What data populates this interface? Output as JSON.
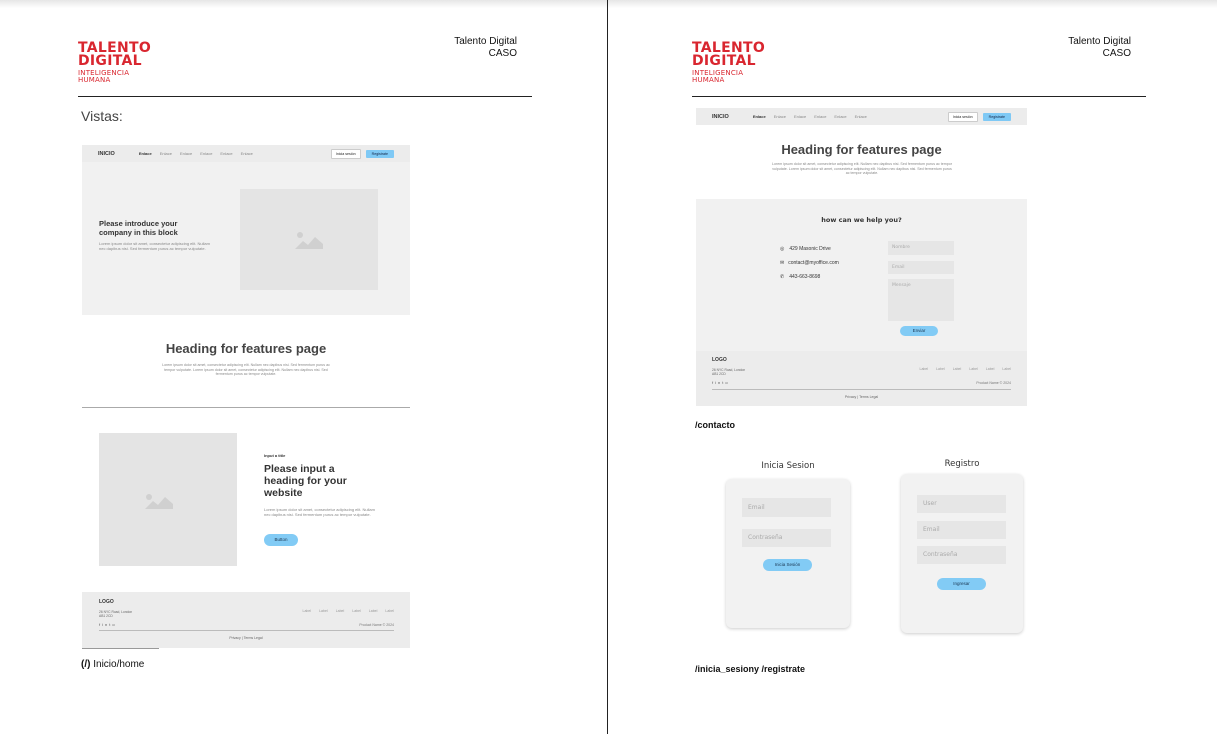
{
  "page1": {
    "logo": {
      "line1": "TALENTO",
      "line2": "DIGITAL",
      "line3": "INTELIGENCIA",
      "line4": "HUMANA"
    },
    "header_right": {
      "line1": "Talento Digital",
      "line2": "CASO"
    },
    "section_title": "Vistas:",
    "home": {
      "nav": {
        "logo": "INICIO",
        "links": [
          "Enlace",
          "Enlace",
          "Enlace",
          "Enlace",
          "Enlace",
          "Enlace"
        ],
        "login": "Inicia sesión",
        "register": "Registrate"
      },
      "hero": {
        "title_line1": "Please introduce your",
        "title_line2": "company in this block",
        "body": "Lorem ipsum dolor sit amet, consectetur adipiscing elit. Nullam nec dapibus nisi. Sed fermentum purus ac tempor vulputate."
      },
      "features": {
        "title": "Heading for features page",
        "body": "Lorem ipsum dolor sit amet, consectetur adipiscing elit. Nullam nec dapibus nisi. Sed fermentum purus ac tempor vulputate. Lorem ipsum dolor sit amet, consectetur adipiscing elit. Nullam nec dapibus nisi. Sed fermentum purus ac tempor vulputate."
      },
      "split": {
        "eyebrow": "Input a title",
        "title_line1": "Please input a",
        "title_line2": "heading for your",
        "title_line3": "website",
        "body": "Lorem ipsum dolor sit amet, consectetur adipiscing elit. Nullam nec dapibus nisi. Sed fermentum purus ac tempor vulputate.",
        "button": "Button"
      },
      "footer": {
        "logo": "LOGO",
        "address1": "26 NYC Road, London",
        "address2": "AB1 2CD",
        "links": [
          "Label",
          "Label",
          "Label",
          "Label",
          "Label",
          "Label"
        ],
        "copyright": "Product Name © 2024",
        "legal": "Privacy | Terms Legal"
      }
    },
    "caption_bold": "(/)",
    "caption": " Inicio/home"
  },
  "page2": {
    "logo": {
      "line1": "TALENTO",
      "line2": "DIGITAL",
      "line3": "INTELIGENCIA",
      "line4": "HUMANA"
    },
    "header_right": {
      "line1": "Talento Digital",
      "line2": "CASO"
    },
    "contact": {
      "nav": {
        "logo": "INICIO",
        "links": [
          "Enlace",
          "Enlace",
          "Enlace",
          "Enlace",
          "Enlace",
          "Enlace"
        ],
        "login": "Inicia sesión",
        "register": "Registrate"
      },
      "features": {
        "title": "Heading for features page",
        "body": "Lorem ipsum dolor sit amet, consectetur adipiscing elit. Nullam nec dapibus nisi. Sed fermentum purus ac tempor vulputate. Lorem ipsum dolor sit amet, consectetur adipiscing elit. Nullam nec dapibus nisi. Sed fermentum purus ac tempor vulputate."
      },
      "help_title": "how can we help you?",
      "address": "429 Masonic Drive",
      "email": "contact@myoffice.com",
      "phone": "443-663-8698",
      "form": {
        "name": "Nombre",
        "email": "Email",
        "message": "Mensaje",
        "send": "Enviar"
      },
      "footer": {
        "logo": "LOGO",
        "address1": "26 NYC Road, London",
        "address2": "AB1 2CD",
        "links": [
          "Label",
          "Label",
          "Label",
          "Label",
          "Label",
          "Label"
        ],
        "copyright": "Product Name © 2024",
        "legal": "Privacy | Terms Legal"
      }
    },
    "caption_contact": "/contacto",
    "login": {
      "title": "Inicia Sesion",
      "email": "Email",
      "password": "Contraseña",
      "button": "Inicia Sesión"
    },
    "register": {
      "title": "Registro",
      "user": "User",
      "email": "Email",
      "password": "Contraseña",
      "button": "Ingresar"
    },
    "caption_auth": "/inicia_sesiony /registrate"
  },
  "colors": {
    "brand_red": "#d9262f",
    "accent_blue": "#82cbf5"
  }
}
